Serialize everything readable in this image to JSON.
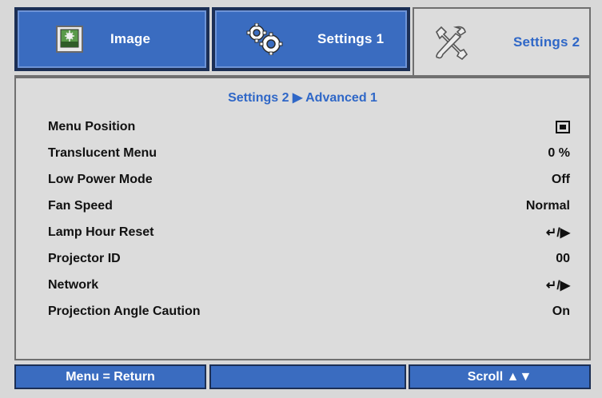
{
  "tabs": [
    {
      "label": "Image",
      "icon": "image-icon",
      "active": false
    },
    {
      "label": "Settings 1",
      "icon": "gears-icon",
      "active": false
    },
    {
      "label": "Settings 2",
      "icon": "tools-icon",
      "active": true
    }
  ],
  "breadcrumb": "Settings 2 ▶ Advanced 1",
  "rows": [
    {
      "label": "Menu Position",
      "value": "",
      "value_icon": "menu-position-icon"
    },
    {
      "label": "Translucent Menu",
      "value": "0 %"
    },
    {
      "label": "Low Power Mode",
      "value": "Off"
    },
    {
      "label": "Fan Speed",
      "value": "Normal"
    },
    {
      "label": "Lamp Hour Reset",
      "value": "↵/▶"
    },
    {
      "label": "Projector ID",
      "value": "00"
    },
    {
      "label": "Network",
      "value": "↵/▶"
    },
    {
      "label": "Projection Angle Caution",
      "value": "On"
    }
  ],
  "footer": {
    "left": "Menu = Return",
    "middle": "",
    "right": "Scroll ▲▼"
  },
  "colors": {
    "tab_blue": "#3a6cc0",
    "accent_text": "#2f67c7",
    "panel_gray": "#dcdcdc"
  }
}
